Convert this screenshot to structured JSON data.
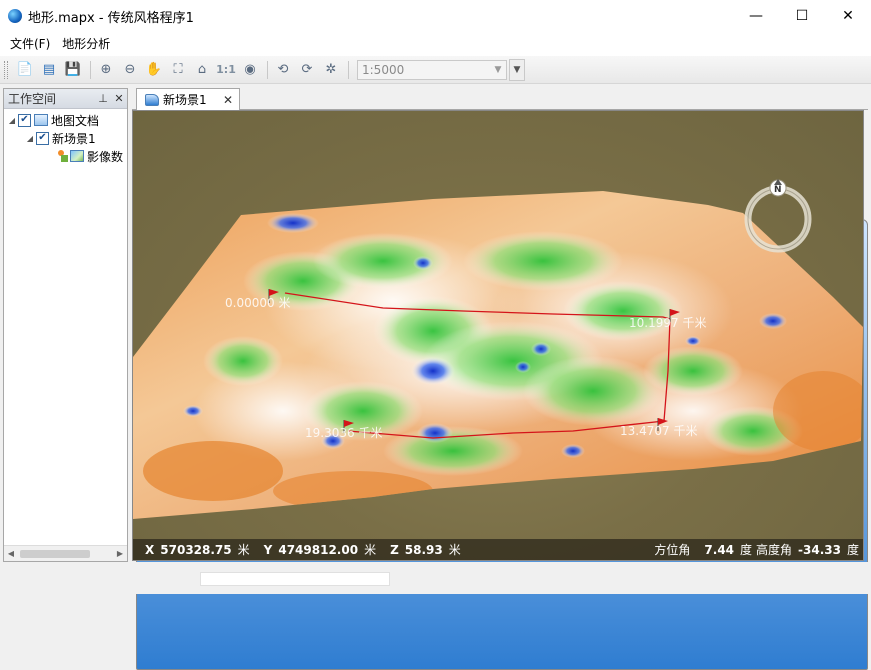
{
  "window": {
    "title": "地形.mapx - 传统风格程序1",
    "minimize": "—",
    "maximize": "☐",
    "close": "✕"
  },
  "menu": {
    "items": [
      "文件(F)",
      "地形分析"
    ]
  },
  "toolbar": {
    "scale_placeholder": "1:5000",
    "one_to_one": "1:1",
    "icons": [
      "new-document-icon",
      "open-icon",
      "save-icon",
      "zoom-in-icon",
      "zoom-out-icon",
      "pan-hand-icon",
      "full-extent-icon",
      "fly-home-icon",
      "one-to-one-icon",
      "visibility-icon",
      "rotate-left-icon",
      "rotate-right-icon",
      "magic-wand-icon"
    ]
  },
  "workspace": {
    "title": "工作空间",
    "pin": "⊥",
    "close": "✕",
    "tree": {
      "root": "地图文档",
      "scene": "新场景1",
      "layer": "影像数"
    }
  },
  "tab": {
    "label": "新场景1",
    "close": "✕"
  },
  "scene": {
    "compass_letter": "N",
    "measure_labels": [
      "0.00000 米",
      "10.1997 千米",
      "19.3036 千米",
      "13.4707 千米"
    ]
  },
  "status": {
    "x_label": "X",
    "x_value": "570328.75",
    "x_unit": "米",
    "y_label": "Y",
    "y_value": "4749812.00",
    "y_unit": "米",
    "z_label": "Z",
    "z_value": "58.93",
    "z_unit": "米",
    "azimuth_label": "方位角",
    "azimuth_value": "7.44",
    "azimuth_unit": "度",
    "elevation_label": "高度角",
    "elevation_value": "-34.33",
    "elevation_unit": "度"
  },
  "colors": {
    "terrain_low": "#e8872e",
    "terrain_mid": "#f6d8b0",
    "terrain_green": "#35c23a",
    "terrain_blue": "#1a3fd6",
    "measure_line": "#d4141a",
    "sky": "#7a6f47"
  }
}
